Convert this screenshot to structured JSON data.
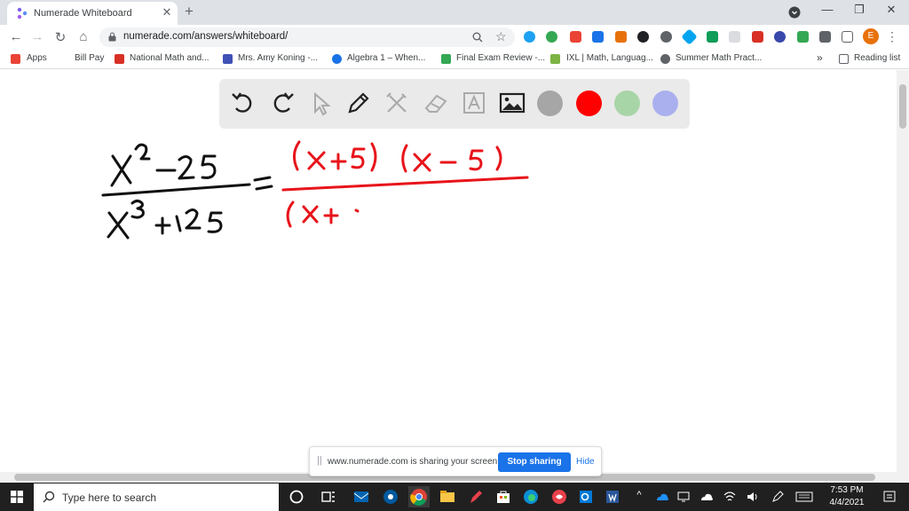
{
  "browser": {
    "tab_title": "Numerade Whiteboard",
    "tab_close": "✕",
    "new_tab": "+",
    "window_controls": {
      "minimize": "—",
      "maximize": "❐",
      "close": "✕"
    },
    "nav": {
      "back": "←",
      "forward": "→",
      "reload": "↻",
      "home": "⌂"
    },
    "url": "numerade.com/answers/whiteboard/",
    "profile_initial": "E",
    "bookmarks": [
      {
        "label": "Apps",
        "color": "#ea4335"
      },
      {
        "label": "Bill Pay",
        "color": "#ffffff"
      },
      {
        "label": "National Math and...",
        "color": "#d93025"
      },
      {
        "label": "Mrs. Amy Koning -...",
        "color": "#3f51b5"
      },
      {
        "label": "Algebra 1 – When...",
        "color": "#1a73e8"
      },
      {
        "label": "Final Exam Review -...",
        "color": "#34a853"
      },
      {
        "label": "IXL | Math, Languag...",
        "color": "#7cb342"
      },
      {
        "label": "Summer Math Pract...",
        "color": "#5f6368"
      }
    ],
    "more_bookmarks": "»",
    "reading_list": "Reading list"
  },
  "whiteboard": {
    "colors": {
      "gray": "#a6a6a6",
      "red": "#ff0000",
      "green": "#a8d5a8",
      "purple": "#aab0ee",
      "ink": "#111111",
      "red_ink": "#e8141b"
    }
  },
  "share_banner": {
    "grip": "||",
    "message": "www.numerade.com is sharing your screen.",
    "stop_label": "Stop sharing",
    "hide_label": "Hide"
  },
  "taskbar": {
    "search_placeholder": "Type here to search",
    "time": "7:53 PM",
    "date": "4/4/2021"
  }
}
